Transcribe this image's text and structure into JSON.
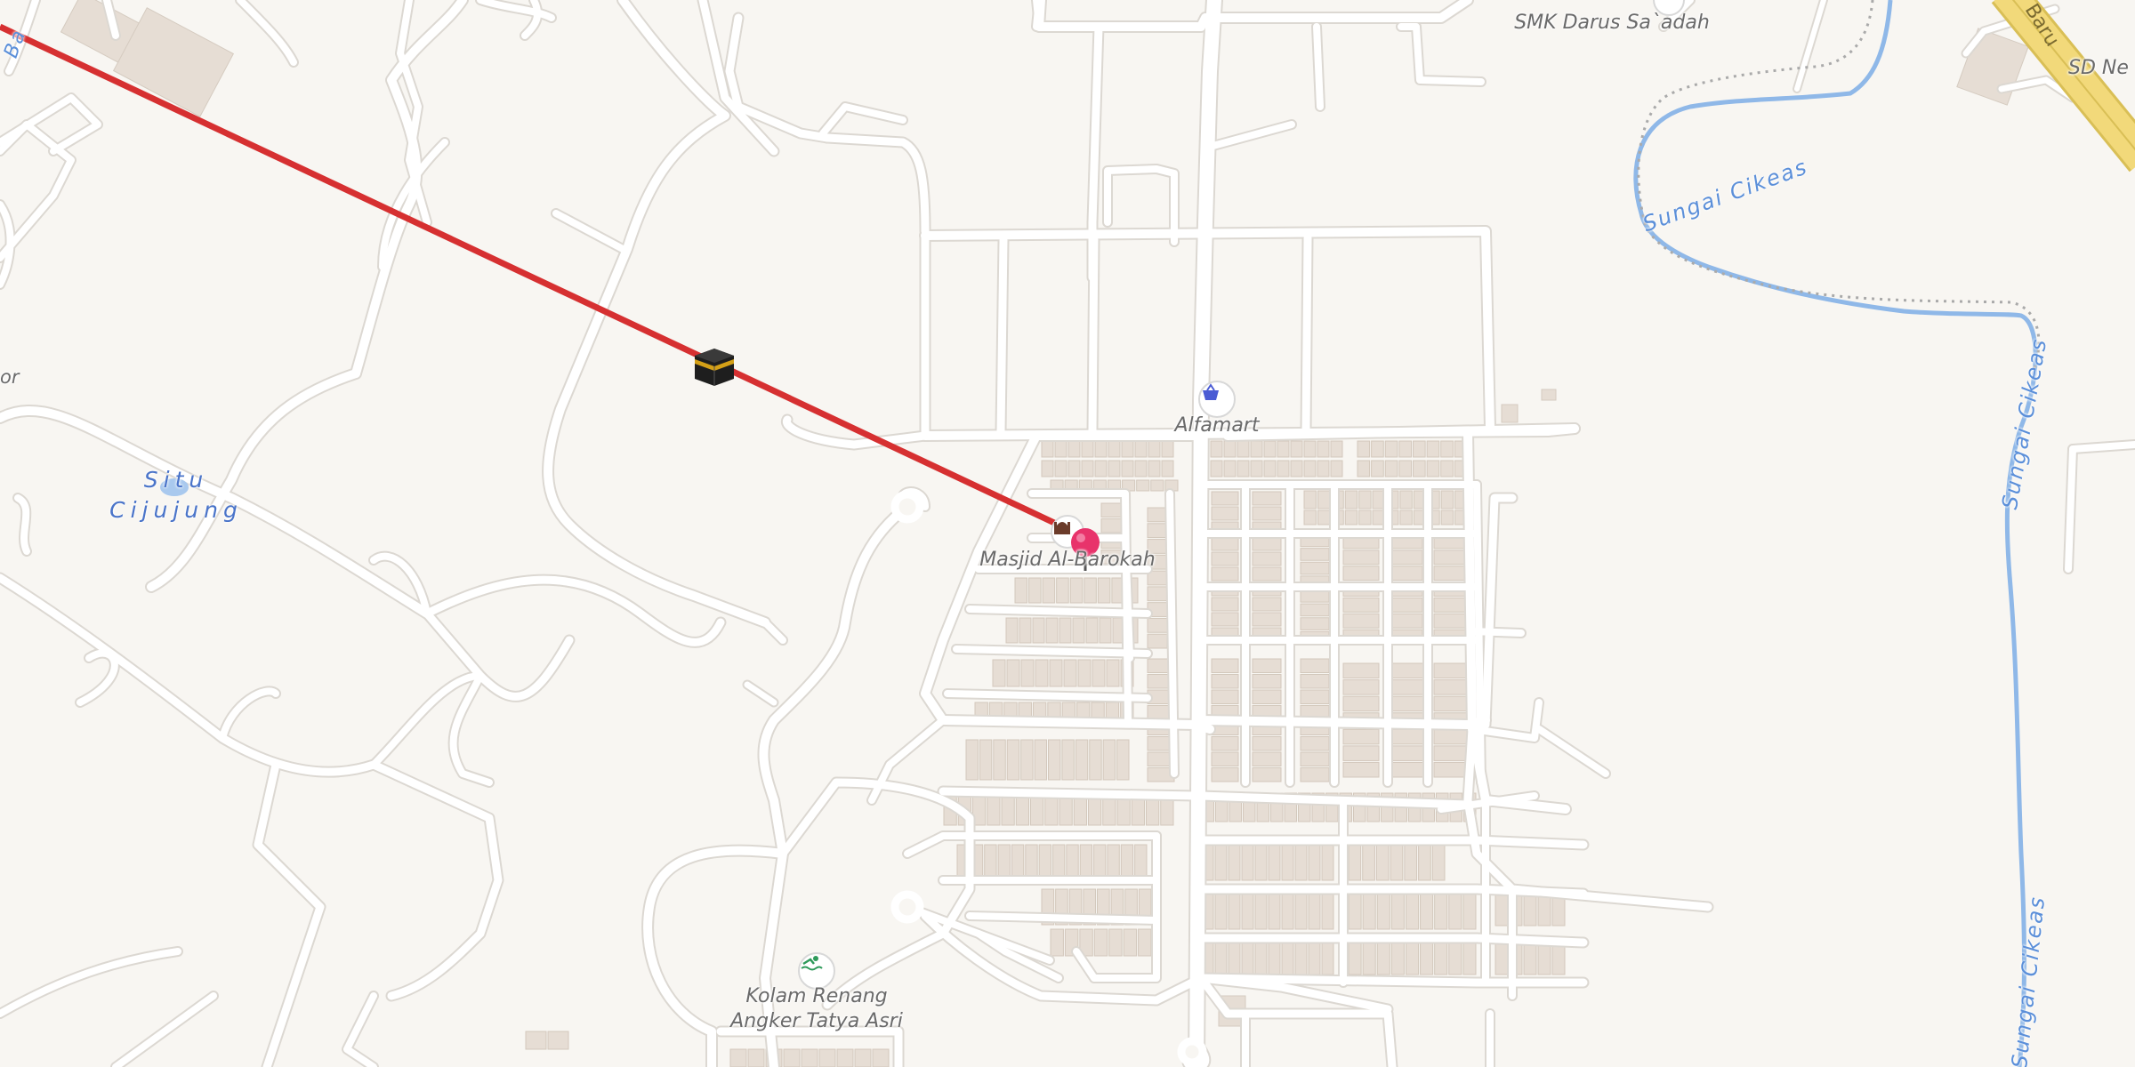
{
  "map": {
    "water_labels": {
      "situ_cijujung": "Situ\nCijujung",
      "sungai_cikeas_top": "Sungai Cikeas",
      "sungai_cikeas_mid": "Sungai Cikeas",
      "sungai_cikeas_bottom": "Sungai Cikeas"
    },
    "road_labels": {
      "baru": "Baru",
      "ba_left": "Ba",
      "or_left": "or"
    },
    "places": {
      "smk": "SMK Darus Sa`adah",
      "sd": "SD Ne",
      "alfamart": "Alfamart",
      "masjid": "Masjid Al-Barokah",
      "kolam": "Kolam Renang\nAngker Tatya Asri"
    },
    "icons": {
      "qibla_marker": "kaaba-icon",
      "selected_pin": "map-pin-icon",
      "mosque": "mosque-icon",
      "shop": "shopping-basket-icon",
      "pool": "swimming-icon",
      "school": "school-icon"
    },
    "colors": {
      "background": "#f8f6f2",
      "road": "#ffffff",
      "road_casing": "#dcd8d2",
      "building": "#e6ddd4",
      "water": "#8fb8e8",
      "qibla_line": "#d63031",
      "pin": "#e8336b",
      "highway": "#f2d97a"
    }
  }
}
